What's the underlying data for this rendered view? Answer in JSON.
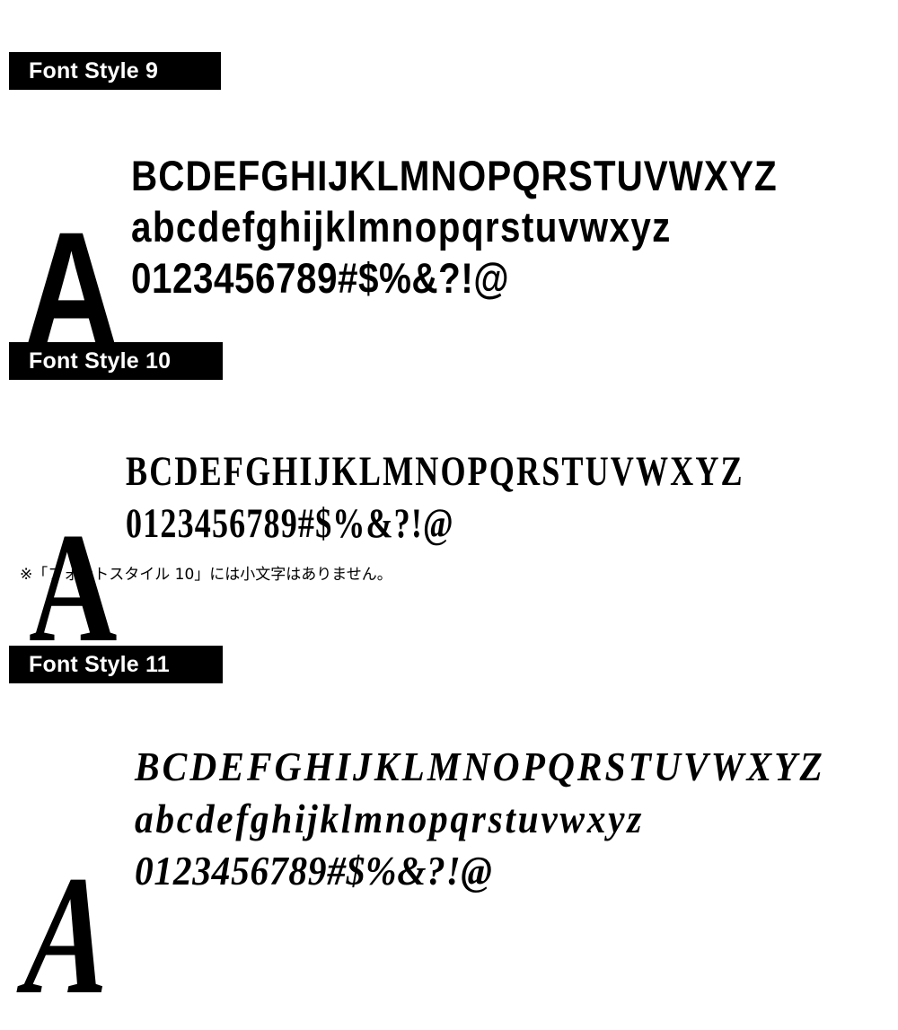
{
  "page": {
    "background_color": "#ffffff",
    "text_color": "#000000",
    "label_bar_color": "#000000",
    "label_text_color": "#ffffff"
  },
  "specimens": [
    {
      "id": "font-style-9",
      "label": "Font Style 9",
      "big_letter": "A",
      "has_lowercase": true,
      "rows": {
        "uppercase": "BCDEFGHIJKLMNOPQRSTUVWXYZ",
        "lowercase": "abcdefghijklmnopqrstuvwxyz",
        "digits_symbols": "0123456789#$%&?!@"
      },
      "note": null
    },
    {
      "id": "font-style-10",
      "label": "Font Style 10",
      "big_letter": "A",
      "has_lowercase": false,
      "rows": {
        "uppercase": "BCDEFGHIJKLMNOPQRSTUVWXYZ",
        "lowercase": null,
        "digits_symbols": "0123456789#$%&?!@"
      },
      "note": "※「フォントスタイル 10」には小文字はありません。"
    },
    {
      "id": "font-style-11",
      "label": "Font Style 11",
      "big_letter": "A",
      "has_lowercase": true,
      "rows": {
        "uppercase": "BCDEFGHIJKLMNOPQRSTUVWXYZ",
        "lowercase": "abcdefghijklmnopqrstuvwxyz",
        "digits_symbols": "0123456789#$%&?!@"
      },
      "note": null
    }
  ]
}
